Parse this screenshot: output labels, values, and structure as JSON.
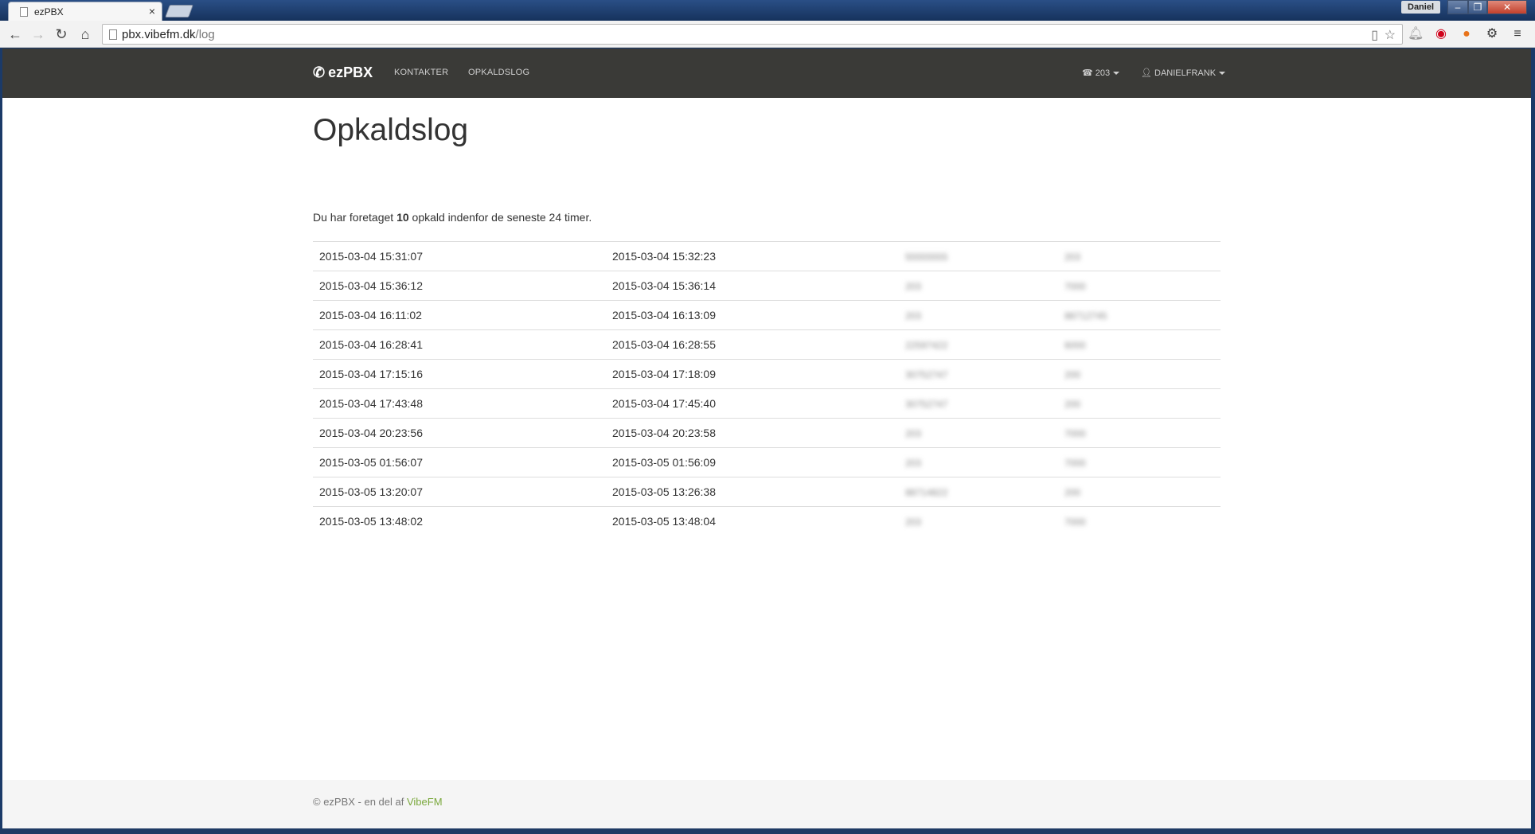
{
  "browser": {
    "tab_title": "ezPBX",
    "tab_close": "×",
    "user_name": "Daniel",
    "url_host": "pbx.vibefm.dk",
    "url_path": "/log"
  },
  "nav": {
    "brand": "ezPBX",
    "links": [
      "KONTAKTER",
      "OPKALDSLOG"
    ],
    "extension": "203",
    "user": "DANIELFRANK"
  },
  "page": {
    "title": "Opkaldslog",
    "summary_prefix": "Du har foretaget ",
    "summary_count": "10",
    "summary_suffix": " opkald indenfor de seneste 24 timer."
  },
  "log": {
    "rows": [
      {
        "start": "2015-03-04 15:31:07",
        "end": "2015-03-04 15:32:23",
        "from": "55555555",
        "to": "203"
      },
      {
        "start": "2015-03-04 15:36:12",
        "end": "2015-03-04 15:36:14",
        "from": "203",
        "to": "7000"
      },
      {
        "start": "2015-03-04 16:11:02",
        "end": "2015-03-04 16:13:09",
        "from": "203",
        "to": "88712745"
      },
      {
        "start": "2015-03-04 16:28:41",
        "end": "2015-03-04 16:28:55",
        "from": "22597422",
        "to": "6000"
      },
      {
        "start": "2015-03-04 17:15:16",
        "end": "2015-03-04 17:18:09",
        "from": "30752747",
        "to": "200"
      },
      {
        "start": "2015-03-04 17:43:48",
        "end": "2015-03-04 17:45:40",
        "from": "30752747",
        "to": "200"
      },
      {
        "start": "2015-03-04 20:23:56",
        "end": "2015-03-04 20:23:58",
        "from": "203",
        "to": "7000"
      },
      {
        "start": "2015-03-05 01:56:07",
        "end": "2015-03-05 01:56:09",
        "from": "203",
        "to": "7000"
      },
      {
        "start": "2015-03-05 13:20:07",
        "end": "2015-03-05 13:26:38",
        "from": "88714822",
        "to": "200"
      },
      {
        "start": "2015-03-05 13:48:02",
        "end": "2015-03-05 13:48:04",
        "from": "203",
        "to": "7000"
      }
    ]
  },
  "footer": {
    "text": "© ezPBX - en del af ",
    "link": "VibeFM"
  }
}
